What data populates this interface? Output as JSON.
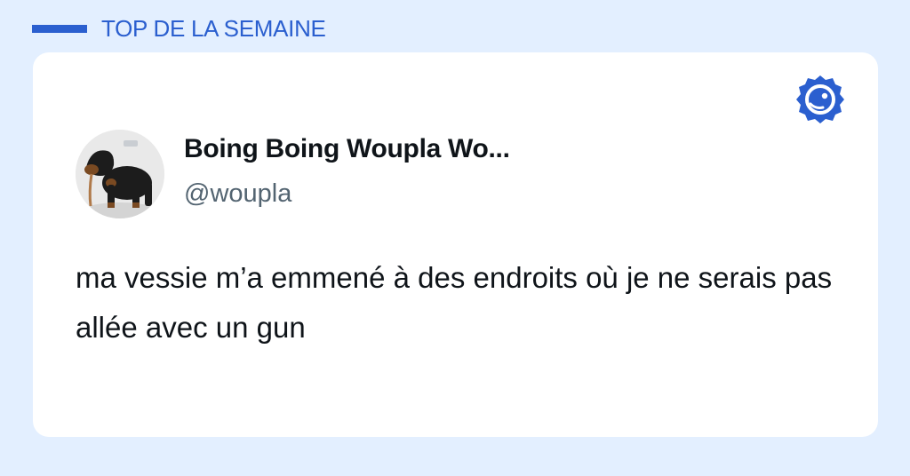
{
  "header": {
    "title": "TOP DE LA SEMAINE",
    "accent_color": "#2b5fcf"
  },
  "tweet": {
    "author": {
      "display_name": "Boing Boing Woupla Wo...",
      "handle": "@woupla",
      "avatar_icon": "dog-avatar"
    },
    "text": "ma vessie m’a emmené à des endroits où je ne serais pas allée avec un gun"
  },
  "brand": {
    "icon": "badge-logo-icon",
    "color": "#2b5fcf"
  }
}
